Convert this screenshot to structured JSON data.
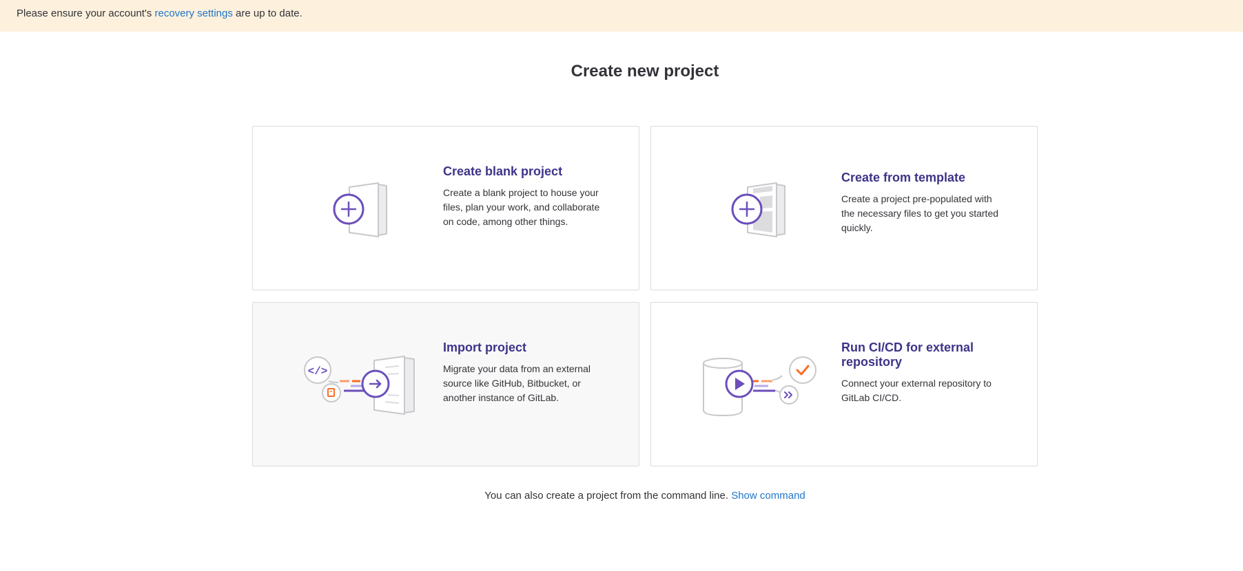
{
  "banner": {
    "text_before": "Please ensure your account's",
    "link": "recovery settings",
    "text_after": "are up to date."
  },
  "page_title": "Create new project",
  "cards": [
    {
      "title": "Create blank project",
      "description": "Create a blank project to house your files, plan your work, and collaborate on code, among other things.",
      "icon": "blank-project-illustration"
    },
    {
      "title": "Create from template",
      "description": "Create a project pre-populated with the necessary files to get you started quickly.",
      "icon": "template-project-illustration"
    },
    {
      "title": "Import project",
      "description": "Migrate your data from an external source like GitHub, Bitbucket, or another instance of GitLab.",
      "icon": "import-project-illustration"
    },
    {
      "title": "Run CI/CD for external repository",
      "description": "Connect your external repository to GitLab CI/CD.",
      "icon": "cicd-illustration"
    }
  ],
  "footer": {
    "text": "You can also create a project from the command line.",
    "link": "Show command"
  },
  "colors": {
    "accent_purple": "#6b4fbb",
    "title_purple": "#3c3489",
    "orange": "#fc6d26",
    "link_blue": "#1f75cb",
    "banner_bg": "#fdf1dd"
  }
}
